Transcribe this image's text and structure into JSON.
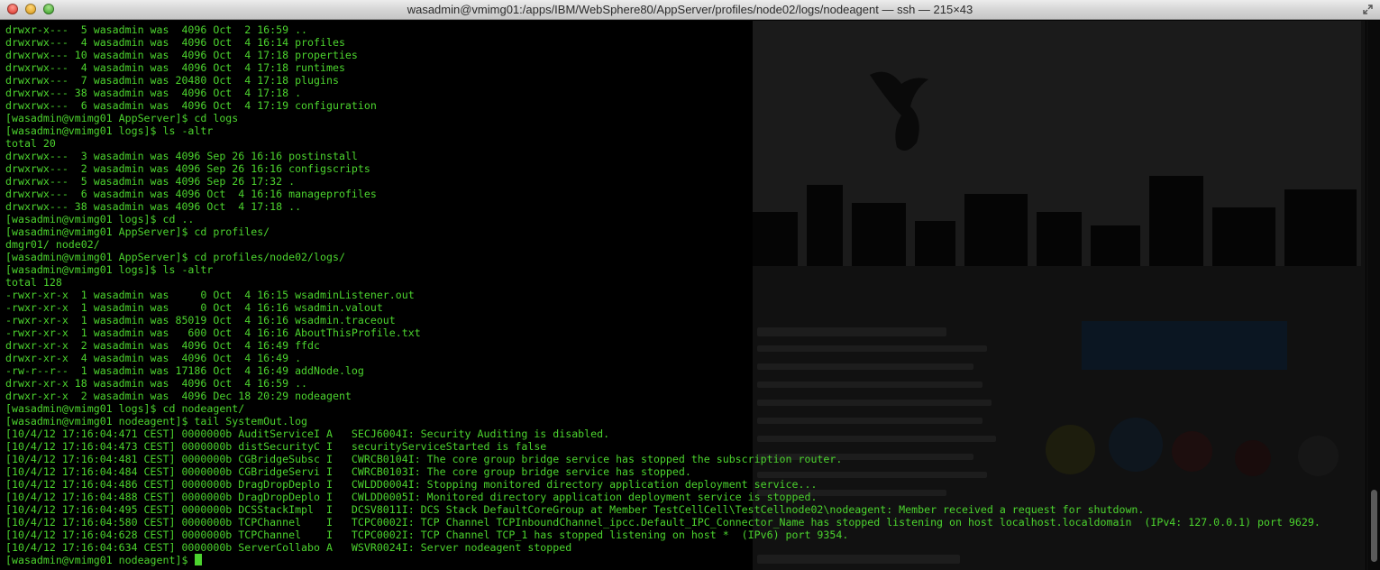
{
  "window": {
    "title": "wasadmin@vmimg01:/apps/IBM/WebSphere80/AppServer/profiles/node02/logs/nodeagent — ssh — 215×43"
  },
  "colors": {
    "terminal_text": "#4cd42e",
    "terminal_background": "#000000",
    "titlebar": "#d4d4d4"
  },
  "icons": {
    "close": "close-icon",
    "minimize": "minimize-icon",
    "zoom": "zoom-icon",
    "fullscreen": "fullscreen-arrows-icon"
  },
  "terminal": {
    "lines": [
      "drwxr-x---  5 wasadmin was  4096 Oct  2 16:59 ..",
      "drwxrwx---  4 wasadmin was  4096 Oct  4 16:14 profiles",
      "drwxrwx--- 10 wasadmin was  4096 Oct  4 17:18 properties",
      "drwxrwx---  4 wasadmin was  4096 Oct  4 17:18 runtimes",
      "drwxrwx---  7 wasadmin was 20480 Oct  4 17:18 plugins",
      "drwxrwx--- 38 wasadmin was  4096 Oct  4 17:18 .",
      "drwxrwx---  6 wasadmin was  4096 Oct  4 17:19 configuration",
      "[wasadmin@vmimg01 AppServer]$ cd logs",
      "[wasadmin@vmimg01 logs]$ ls -altr",
      "total 20",
      "drwxrwx---  3 wasadmin was 4096 Sep 26 16:16 postinstall",
      "drwxrwx---  2 wasadmin was 4096 Sep 26 16:16 configscripts",
      "drwxrwx---  5 wasadmin was 4096 Sep 26 17:32 .",
      "drwxrwx---  6 wasadmin was 4096 Oct  4 16:16 manageprofiles",
      "drwxrwx--- 38 wasadmin was 4096 Oct  4 17:18 ..",
      "[wasadmin@vmimg01 logs]$ cd ..",
      "[wasadmin@vmimg01 AppServer]$ cd profiles/",
      "dmgr01/ node02/",
      "[wasadmin@vmimg01 AppServer]$ cd profiles/node02/logs/",
      "[wasadmin@vmimg01 logs]$ ls -altr",
      "total 128",
      "-rwxr-xr-x  1 wasadmin was     0 Oct  4 16:15 wsadminListener.out",
      "-rwxr-xr-x  1 wasadmin was     0 Oct  4 16:16 wsadmin.valout",
      "-rwxr-xr-x  1 wasadmin was 85019 Oct  4 16:16 wsadmin.traceout",
      "-rwxr-xr-x  1 wasadmin was   600 Oct  4 16:16 AboutThisProfile.txt",
      "drwxr-xr-x  2 wasadmin was  4096 Oct  4 16:49 ffdc",
      "drwxr-xr-x  4 wasadmin was  4096 Oct  4 16:49 .",
      "-rw-r--r--  1 wasadmin was 17186 Oct  4 16:49 addNode.log",
      "drwxr-xr-x 18 wasadmin was  4096 Oct  4 16:59 ..",
      "drwxr-xr-x  2 wasadmin was  4096 Dec 18 20:29 nodeagent",
      "[wasadmin@vmimg01 logs]$ cd nodeagent/",
      "[wasadmin@vmimg01 nodeagent]$ tail SystemOut.log",
      "[10/4/12 17:16:04:471 CEST] 0000000b AuditServiceI A   SECJ6004I: Security Auditing is disabled.",
      "[10/4/12 17:16:04:473 CEST] 0000000b distSecurityC I   securityServiceStarted is false",
      "[10/4/12 17:16:04:481 CEST] 0000000b CGBridgeSubsc I   CWRCB0104I: The core group bridge service has stopped the subscription router.",
      "[10/4/12 17:16:04:484 CEST] 0000000b CGBridgeServi I   CWRCB0103I: The core group bridge service has stopped.",
      "[10/4/12 17:16:04:486 CEST] 0000000b DragDropDeplo I   CWLDD0004I: Stopping monitored directory application deployment service...",
      "[10/4/12 17:16:04:488 CEST] 0000000b DragDropDeplo I   CWLDD0005I: Monitored directory application deployment service is stopped.",
      "[10/4/12 17:16:04:495 CEST] 0000000b DCSStackImpl  I   DCSV8011I: DCS Stack DefaultCoreGroup at Member TestCellCell\\TestCellnode02\\nodeagent: Member received a request for shutdown.",
      "[10/4/12 17:16:04:580 CEST] 0000000b TCPChannel    I   TCPC0002I: TCP Channel TCPInboundChannel_ipcc.Default_IPC_Connector_Name has stopped listening on host localhost.localdomain  (IPv4: 127.0.0.1) port 9629.",
      "[10/4/12 17:16:04:628 CEST] 0000000b TCPChannel    I   TCPC0002I: TCP Channel TCP_1 has stopped listening on host *  (IPv6) port 9354.",
      "[10/4/12 17:16:04:634 CEST] 0000000b ServerCollabo A   WSVR0024I: Server nodeagent stopped"
    ],
    "prompt": "[wasadmin@vmimg01 nodeagent]$ "
  }
}
